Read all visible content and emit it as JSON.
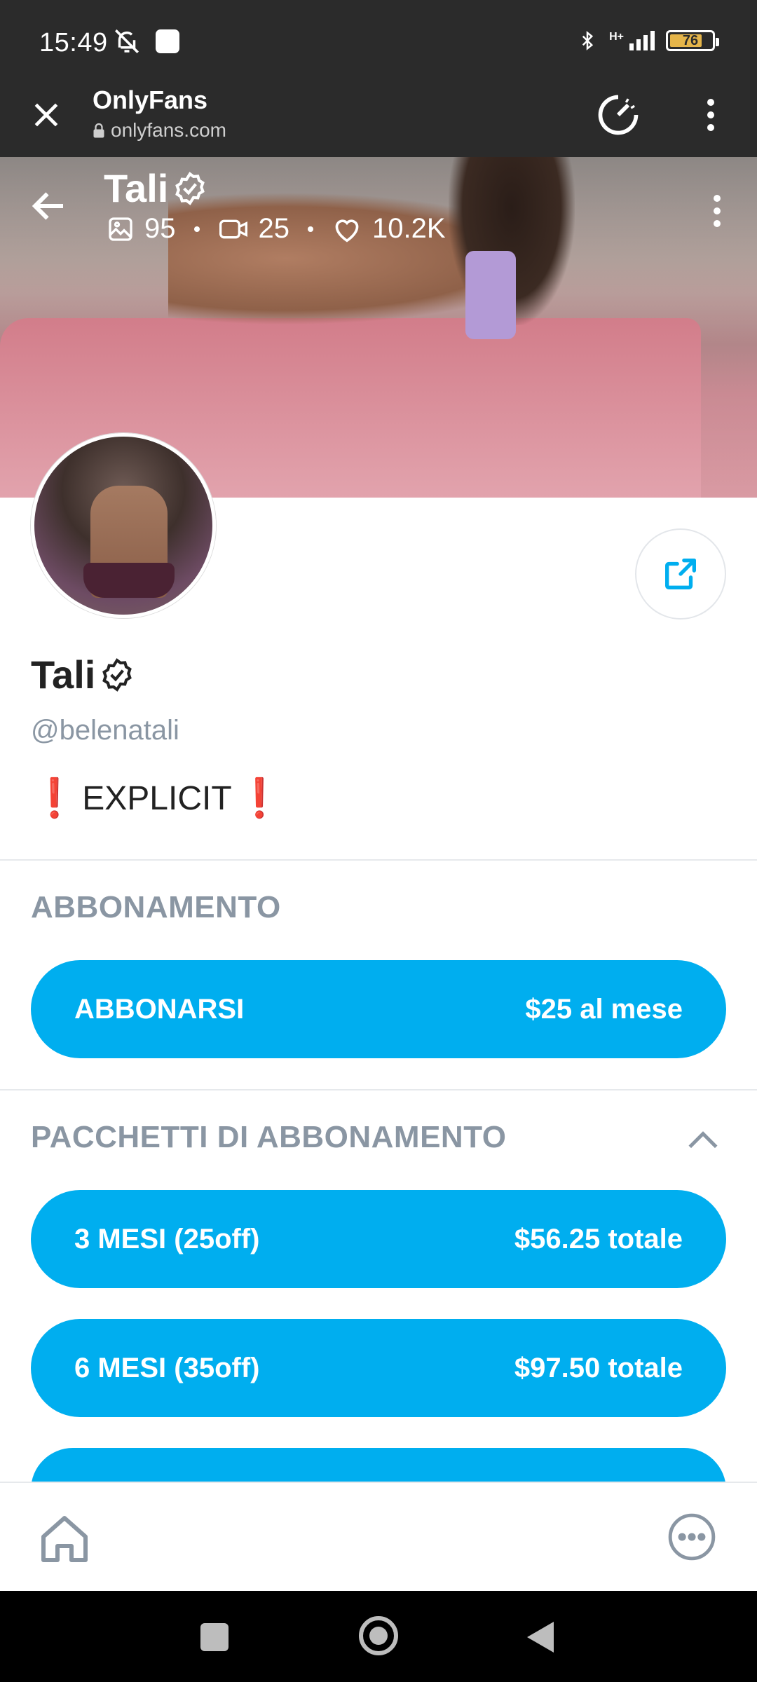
{
  "status_bar": {
    "time": "15:49",
    "network": "H+",
    "battery": "76"
  },
  "browser": {
    "title": "OnlyFans",
    "url": "onlyfans.com"
  },
  "profile": {
    "name": "Tali",
    "photos_count": "95",
    "videos_count": "25",
    "likes_count": "10.2K",
    "handle": "@belenatali",
    "bio_mark_left": "❗",
    "bio_text": "EXPLICIT",
    "bio_mark_right": "❗"
  },
  "subscription": {
    "section_title": "ABBONAMENTO",
    "button_label": "ABBONARSI",
    "button_price": "$25 al mese"
  },
  "bundles": {
    "section_title": "PACCHETTI DI ABBONAMENTO",
    "items": [
      {
        "label": "3 MESI (25off)",
        "price": "$56.25 totale"
      },
      {
        "label": "6 MESI (35off)",
        "price": "$97.50 totale"
      }
    ]
  },
  "colors": {
    "accent": "#00aeef",
    "muted": "#8a96a3",
    "bar": "#2b2b2b"
  }
}
